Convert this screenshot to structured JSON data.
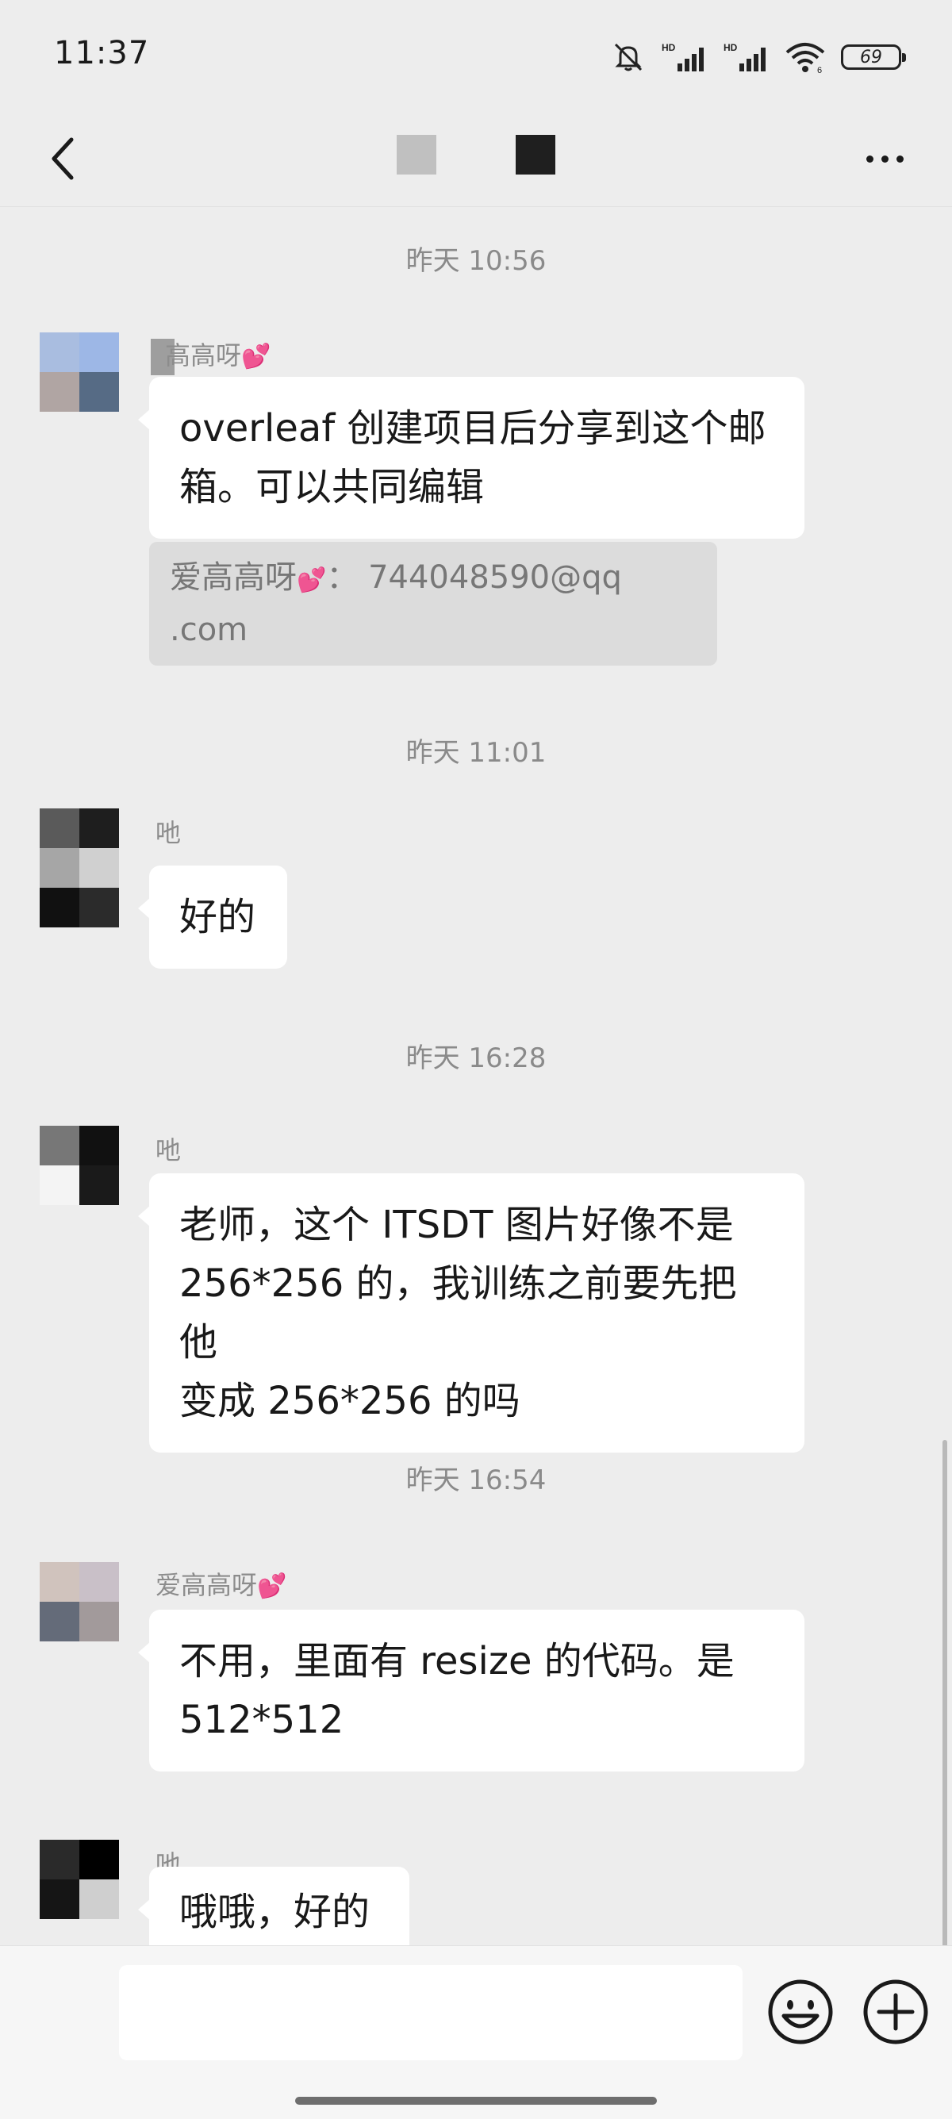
{
  "status_bar": {
    "time": "11:37",
    "battery": "69"
  },
  "colors": {
    "background": "#ededed",
    "bubble": "#ffffff",
    "quote": "#dcdcdc",
    "timestamp": "#8a8a8a",
    "heart": "#ff4fa3"
  },
  "icons": [
    "back-icon",
    "more-icon",
    "mute-icon",
    "signal-icon",
    "wifi-icon",
    "battery-icon",
    "emoji-icon",
    "plus-icon"
  ],
  "chat": {
    "timestamps": [
      "昨天 10:56",
      "昨天 11:01",
      "昨天 16:28",
      "昨天 16:54"
    ],
    "messages": [
      {
        "sender": "高高呀",
        "lines": [
          "overleaf 创建项目后分享到这个邮",
          "箱。可以共同编辑"
        ]
      },
      {
        "sender": "吔",
        "lines": [
          "好的"
        ]
      },
      {
        "sender": "吔",
        "lines": [
          "老师，这个 ITSDT 图片好像不是",
          "256*256 的，我训练之前要先把他",
          "变成 256*256 的吗"
        ]
      },
      {
        "sender": "爱高高呀",
        "lines": [
          "不用，里面有 resize 的代码。是",
          "512*512"
        ]
      },
      {
        "sender": "吔",
        "lines": [
          "哦哦，好的"
        ]
      }
    ],
    "quote": {
      "line1_prefix": "爱高高呀",
      "line1_suffix": "：  744048590@qq",
      "line2": ".com"
    }
  },
  "input": {
    "value": ""
  }
}
